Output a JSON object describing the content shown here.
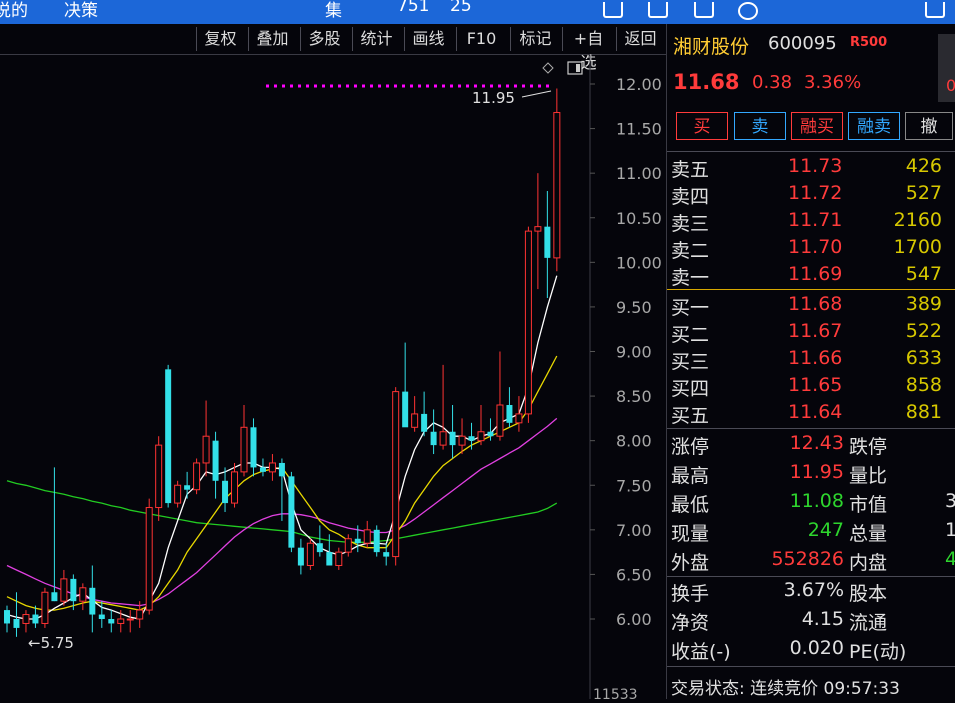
{
  "topbar": {
    "left_text_1": "说的",
    "left_text_2": "决策",
    "mid_text": "集",
    "mid_text_2": "751",
    "mid_text_3": "25"
  },
  "toolbar": {
    "buttons": [
      "复权",
      "叠加",
      "多股",
      "统计",
      "画线",
      "F10",
      "标记",
      "+自选",
      "返回"
    ]
  },
  "chart": {
    "y_ticks": [
      "12.00",
      "11.50",
      "11.00",
      "10.50",
      "10.00",
      "9.50",
      "9.00",
      "8.50",
      "8.00",
      "7.50",
      "7.00",
      "6.50",
      "6.00"
    ],
    "high_label": "11.95",
    "low_label": "5.75",
    "bottom_label": "11533",
    "colors": {
      "up": "#ff3333",
      "down": "#33e0e8",
      "ma5": "#ffffff",
      "ma10": "#e8d800",
      "ma20": "#e040e0",
      "ma60": "#22cc22",
      "limit_dots": "#ff00ff"
    }
  },
  "chart_data": {
    "type": "candlestick",
    "ylim": [
      5.5,
      12.25
    ],
    "ohlc": [
      [
        6.1,
        6.15,
        5.85,
        5.95
      ],
      [
        6.0,
        6.3,
        5.8,
        5.9
      ],
      [
        5.95,
        6.1,
        5.85,
        6.05
      ],
      [
        6.05,
        6.15,
        5.9,
        5.95
      ],
      [
        5.95,
        6.35,
        5.9,
        6.3
      ],
      [
        6.3,
        7.7,
        6.2,
        6.2
      ],
      [
        6.2,
        6.55,
        6.15,
        6.45
      ],
      [
        6.45,
        6.5,
        6.1,
        6.2
      ],
      [
        6.2,
        6.4,
        6.1,
        6.35
      ],
      [
        6.35,
        6.6,
        5.85,
        6.05
      ],
      [
        6.05,
        6.2,
        5.9,
        6.0
      ],
      [
        6.0,
        6.1,
        5.85,
        5.95
      ],
      [
        5.95,
        6.1,
        5.85,
        6.0
      ],
      [
        6.0,
        6.1,
        5.85,
        6.0
      ],
      [
        6.0,
        6.2,
        5.9,
        6.1
      ],
      [
        6.1,
        7.35,
        6.05,
        7.25
      ],
      [
        7.25,
        8.05,
        7.1,
        7.95
      ],
      [
        8.8,
        8.85,
        7.25,
        7.3
      ],
      [
        7.3,
        7.55,
        7.25,
        7.5
      ],
      [
        7.5,
        7.65,
        7.35,
        7.45
      ],
      [
        7.45,
        7.8,
        7.4,
        7.75
      ],
      [
        7.75,
        8.45,
        7.6,
        8.05
      ],
      [
        8.0,
        8.1,
        7.35,
        7.55
      ],
      [
        7.55,
        7.7,
        7.2,
        7.3
      ],
      [
        7.3,
        7.75,
        7.25,
        7.65
      ],
      [
        7.65,
        8.4,
        7.6,
        8.15
      ],
      [
        8.15,
        8.25,
        7.6,
        7.7
      ],
      [
        7.7,
        7.8,
        7.6,
        7.65
      ],
      [
        7.65,
        7.85,
        7.55,
        7.75
      ],
      [
        7.75,
        7.8,
        7.1,
        7.6
      ],
      [
        7.6,
        7.65,
        6.75,
        6.8
      ],
      [
        6.8,
        6.9,
        6.5,
        6.6
      ],
      [
        6.6,
        6.9,
        6.55,
        6.85
      ],
      [
        6.85,
        7.05,
        6.7,
        6.75
      ],
      [
        6.75,
        6.95,
        6.6,
        6.6
      ],
      [
        6.6,
        6.8,
        6.55,
        6.75
      ],
      [
        6.75,
        6.95,
        6.7,
        6.9
      ],
      [
        6.9,
        7.05,
        6.75,
        6.85
      ],
      [
        6.85,
        7.1,
        6.8,
        7.0
      ],
      [
        7.0,
        7.05,
        6.7,
        6.75
      ],
      [
        6.75,
        6.85,
        6.6,
        6.7
      ],
      [
        6.7,
        8.6,
        6.6,
        8.55
      ],
      [
        8.55,
        9.1,
        8.2,
        8.15
      ],
      [
        8.15,
        8.5,
        8.1,
        8.3
      ],
      [
        8.3,
        8.55,
        8.05,
        8.1
      ],
      [
        8.1,
        8.35,
        7.85,
        7.95
      ],
      [
        7.95,
        8.85,
        7.9,
        8.1
      ],
      [
        8.1,
        8.4,
        7.8,
        7.95
      ],
      [
        7.95,
        8.25,
        7.85,
        8.05
      ],
      [
        8.05,
        8.2,
        7.9,
        8.0
      ],
      [
        8.0,
        8.4,
        7.95,
        8.1
      ],
      [
        8.1,
        8.25,
        8.0,
        8.05
      ],
      [
        8.05,
        9.0,
        8.0,
        8.4
      ],
      [
        8.4,
        8.6,
        8.15,
        8.2
      ],
      [
        8.2,
        8.5,
        8.1,
        8.3
      ],
      [
        8.3,
        10.4,
        8.2,
        10.35
      ],
      [
        10.35,
        11.0,
        9.7,
        10.4
      ],
      [
        10.4,
        10.8,
        9.6,
        10.05
      ],
      [
        10.05,
        11.95,
        9.9,
        11.68
      ]
    ],
    "ma5": [
      6.05,
      6.02,
      6.0,
      6.0,
      6.05,
      6.12,
      6.18,
      6.24,
      6.29,
      6.21,
      6.13,
      6.1,
      6.06,
      6.02,
      6.0,
      6.2,
      6.4,
      6.8,
      7.1,
      7.4,
      7.5,
      7.65,
      7.62,
      7.65,
      7.7,
      7.75,
      7.75,
      7.7,
      7.7,
      7.68,
      7.3,
      7.0,
      6.9,
      6.8,
      6.75,
      6.72,
      6.76,
      6.82,
      6.85,
      6.85,
      6.84,
      7.2,
      7.6,
      7.9,
      8.1,
      8.2,
      8.15,
      8.05,
      8.05,
      8.0,
      8.05,
      8.08,
      8.2,
      8.25,
      8.3,
      8.6,
      9.1,
      9.5,
      9.85
    ],
    "ma10": [
      6.25,
      6.2,
      6.15,
      6.12,
      6.1,
      6.1,
      6.12,
      6.15,
      6.18,
      6.2,
      6.18,
      6.16,
      6.14,
      6.12,
      6.1,
      6.15,
      6.25,
      6.4,
      6.55,
      6.75,
      6.9,
      7.05,
      7.2,
      7.35,
      7.45,
      7.55,
      7.62,
      7.66,
      7.68,
      7.7,
      7.55,
      7.4,
      7.25,
      7.1,
      7.0,
      6.95,
      6.88,
      6.83,
      6.8,
      6.8,
      6.8,
      6.95,
      7.1,
      7.3,
      7.45,
      7.6,
      7.72,
      7.8,
      7.88,
      7.95,
      8.0,
      8.05,
      8.1,
      8.15,
      8.2,
      8.35,
      8.55,
      8.75,
      8.95
    ],
    "ma20": [
      6.6,
      6.55,
      6.5,
      6.45,
      6.4,
      6.36,
      6.32,
      6.28,
      6.25,
      6.22,
      6.2,
      6.18,
      6.17,
      6.16,
      6.15,
      6.17,
      6.22,
      6.28,
      6.36,
      6.44,
      6.52,
      6.62,
      6.72,
      6.82,
      6.92,
      7.0,
      7.07,
      7.12,
      7.16,
      7.18,
      7.18,
      7.17,
      7.15,
      7.12,
      7.08,
      7.05,
      7.02,
      7.0,
      6.98,
      6.97,
      6.97,
      7.0,
      7.05,
      7.12,
      7.2,
      7.28,
      7.36,
      7.44,
      7.52,
      7.6,
      7.68,
      7.74,
      7.8,
      7.86,
      7.92,
      8.0,
      8.08,
      8.16,
      8.25
    ],
    "ma60": [
      7.55,
      7.52,
      7.5,
      7.47,
      7.44,
      7.42,
      7.4,
      7.37,
      7.35,
      7.32,
      7.3,
      7.27,
      7.25,
      7.22,
      7.2,
      7.18,
      7.16,
      7.14,
      7.12,
      7.1,
      7.08,
      7.07,
      7.06,
      7.05,
      7.04,
      7.03,
      7.02,
      7.01,
      7.0,
      6.99,
      6.98,
      6.95,
      6.92,
      6.9,
      6.88,
      6.87,
      6.86,
      6.86,
      6.86,
      6.87,
      6.88,
      6.9,
      6.92,
      6.94,
      6.96,
      6.98,
      7.0,
      7.02,
      7.04,
      7.06,
      7.08,
      7.1,
      7.12,
      7.14,
      7.16,
      7.18,
      7.2,
      7.24,
      7.3
    ],
    "limit_up": 12.0
  },
  "quote": {
    "name": "湘财股份",
    "code": "600095",
    "r_badge": "R500",
    "price": "11.68",
    "change": "0.38",
    "percent": "3.36%",
    "side_value": "0",
    "buttons": [
      "买",
      "卖",
      "融买",
      "融卖",
      "撤"
    ],
    "asks": [
      {
        "label": "卖五",
        "price": "11.73",
        "vol": "426"
      },
      {
        "label": "卖四",
        "price": "11.72",
        "vol": "527"
      },
      {
        "label": "卖三",
        "price": "11.71",
        "vol": "2160"
      },
      {
        "label": "卖二",
        "price": "11.70",
        "vol": "1700"
      },
      {
        "label": "卖一",
        "price": "11.69",
        "vol": "547"
      }
    ],
    "bids": [
      {
        "label": "买一",
        "price": "11.68",
        "vol": "389"
      },
      {
        "label": "买二",
        "price": "11.67",
        "vol": "522"
      },
      {
        "label": "买三",
        "price": "11.66",
        "vol": "633"
      },
      {
        "label": "买四",
        "price": "11.65",
        "vol": "858"
      },
      {
        "label": "买五",
        "price": "11.64",
        "vol": "881"
      }
    ],
    "stats": [
      {
        "l1": "涨停",
        "v1": "12.43",
        "c1": "red",
        "l2": "跌停",
        "v2": "",
        "c2": "green"
      },
      {
        "l1": "最高",
        "v1": "11.95",
        "c1": "red",
        "l2": "量比",
        "v2": "",
        "c2": "white"
      },
      {
        "l1": "最低",
        "v1": "11.08",
        "c1": "green",
        "l2": "市值",
        "v2": "3",
        "c2": "white"
      },
      {
        "l1": "现量",
        "v1": "247",
        "c1": "green",
        "l2": "总量",
        "v2": "1",
        "c2": "white"
      },
      {
        "l1": "外盘",
        "v1": "552826",
        "c1": "red",
        "l2": "内盘",
        "v2": "4",
        "c2": "green"
      }
    ],
    "stats2": [
      {
        "l1": "换手",
        "v1": "3.67%",
        "c1": "white",
        "l2": "股本",
        "v2": "",
        "c2": "white"
      },
      {
        "l1": "净资",
        "v1": "4.15",
        "c1": "white",
        "l2": "流通",
        "v2": "",
        "c2": "white"
      },
      {
        "l1": "收益(-)",
        "v1": "0.020",
        "c1": "white",
        "l2": "PE(动)",
        "v2": "",
        "c2": "white"
      }
    ],
    "status": "交易状态: 连续竞价 09:57:33"
  }
}
